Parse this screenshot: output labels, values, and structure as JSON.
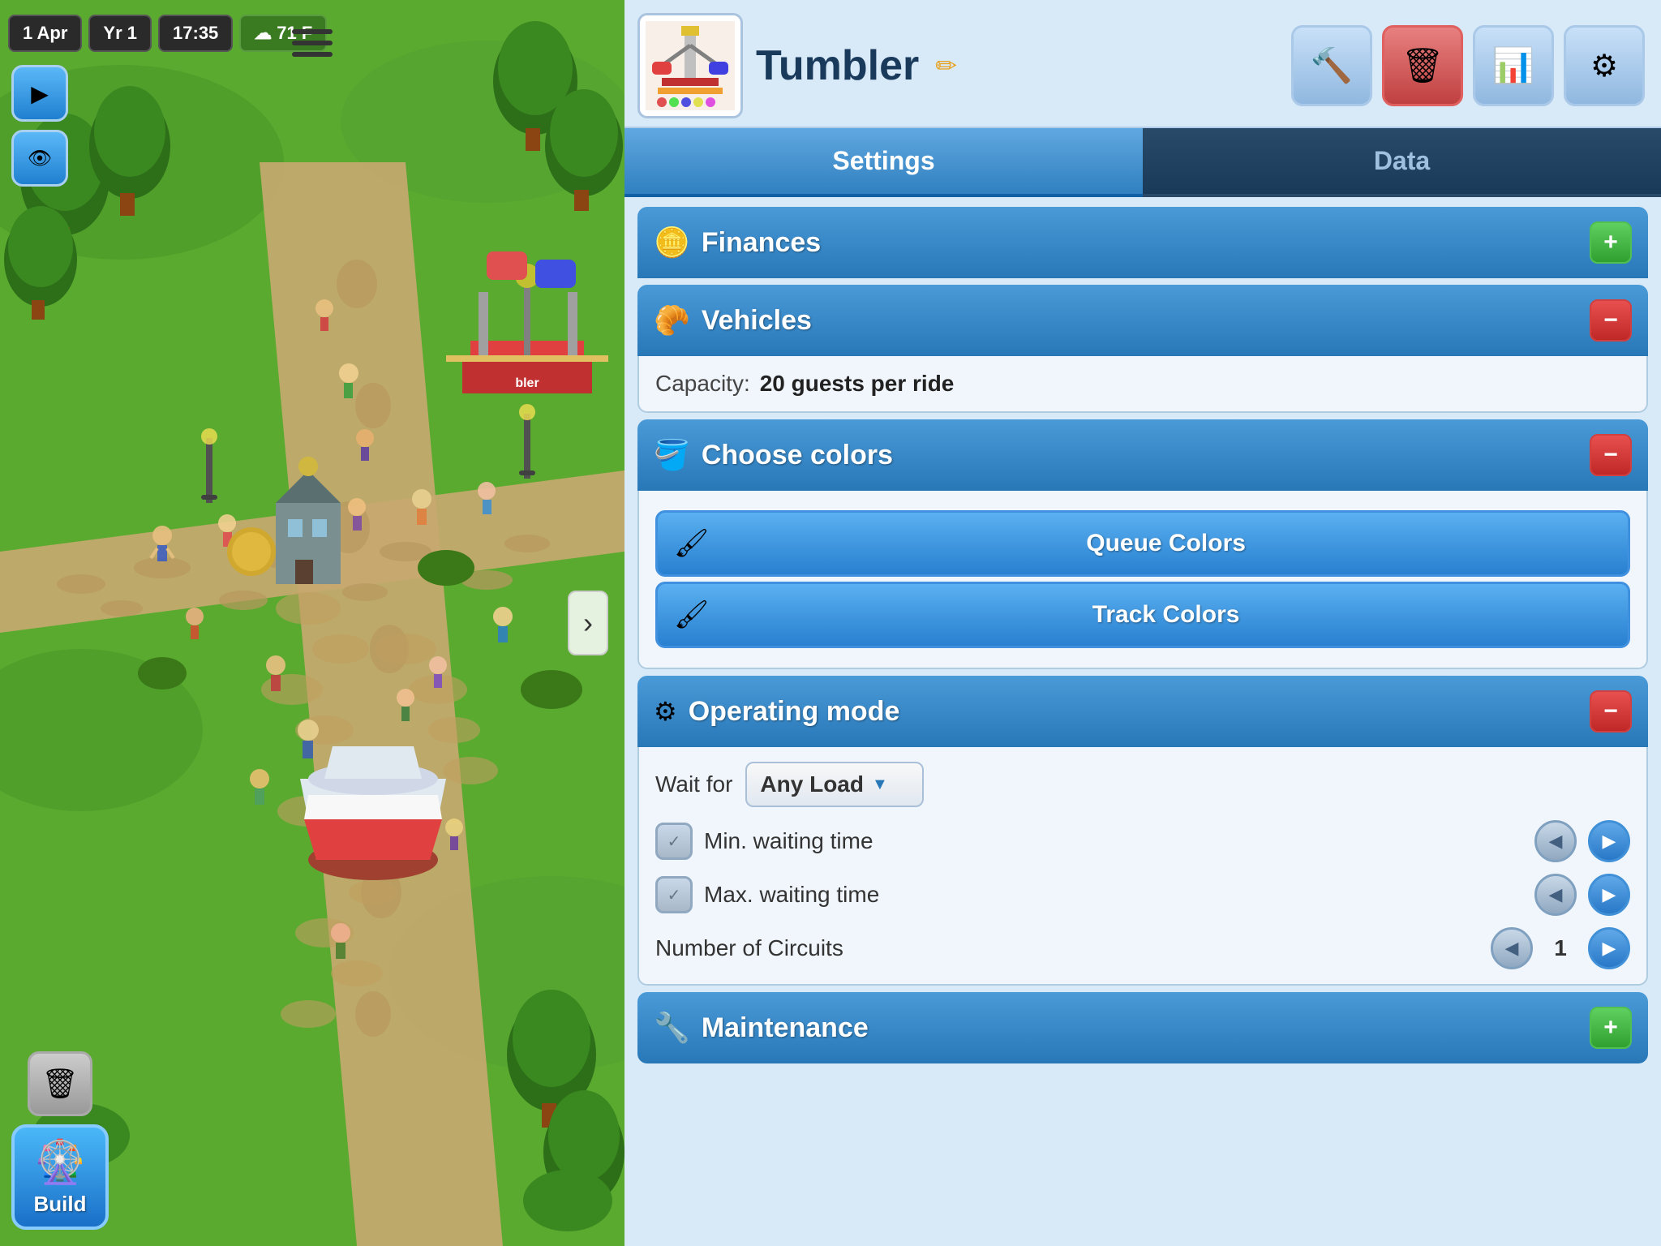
{
  "game": {
    "date": "1 Apr",
    "year": "Yr 1",
    "time": "17:35",
    "weather_icon": "☁",
    "temperature": "71 F",
    "hamburger_label": "≡"
  },
  "hud": {
    "play_icon": "▶",
    "view_icon": "👁",
    "trash_label": "🗑",
    "build_label": "Build",
    "build_icon": "🎡",
    "chevron": "›"
  },
  "ride": {
    "title": "Tumbler",
    "thumbnail_icon": "🎢",
    "edit_icon": "✏",
    "action_buttons": [
      {
        "icon": "🔨",
        "color": "normal",
        "name": "repair"
      },
      {
        "icon": "🗑",
        "color": "red",
        "name": "delete"
      },
      {
        "icon": "📊",
        "color": "normal",
        "name": "stats"
      },
      {
        "icon": "⚙",
        "color": "normal",
        "name": "settings"
      }
    ]
  },
  "tabs": [
    {
      "label": "Settings",
      "active": true
    },
    {
      "label": "Data",
      "active": false
    }
  ],
  "sections": {
    "finances": {
      "label": "Finances",
      "icon": "🪙",
      "expanded": false,
      "expand_type": "green",
      "expand_symbol": "+"
    },
    "vehicles": {
      "label": "Vehicles",
      "icon": "🥐",
      "expanded": true,
      "expand_type": "red",
      "expand_symbol": "−",
      "capacity_label": "Capacity:",
      "capacity_value": "20 guests per ride"
    },
    "colors": {
      "label": "Choose colors",
      "icon": "🪣",
      "expanded": true,
      "expand_type": "red",
      "expand_symbol": "−",
      "buttons": [
        {
          "label": "Queue Colors",
          "paint_icon": "🖌"
        },
        {
          "label": "Track Colors",
          "paint_icon": "🖌"
        }
      ]
    },
    "operating_mode": {
      "label": "Operating mode",
      "icon": "⚙",
      "expanded": true,
      "expand_type": "red",
      "expand_symbol": "−",
      "wait_label": "Wait for",
      "wait_value": "Any Load",
      "dropdown_arrow": "▼",
      "min_waiting_label": "Min. waiting time",
      "max_waiting_label": "Max. waiting time",
      "circuits_label": "Number of Circuits",
      "circuits_value": "1"
    },
    "maintenance": {
      "label": "Maintenance",
      "icon": "🔧",
      "expanded": false,
      "expand_type": "green",
      "expand_symbol": "+"
    }
  }
}
